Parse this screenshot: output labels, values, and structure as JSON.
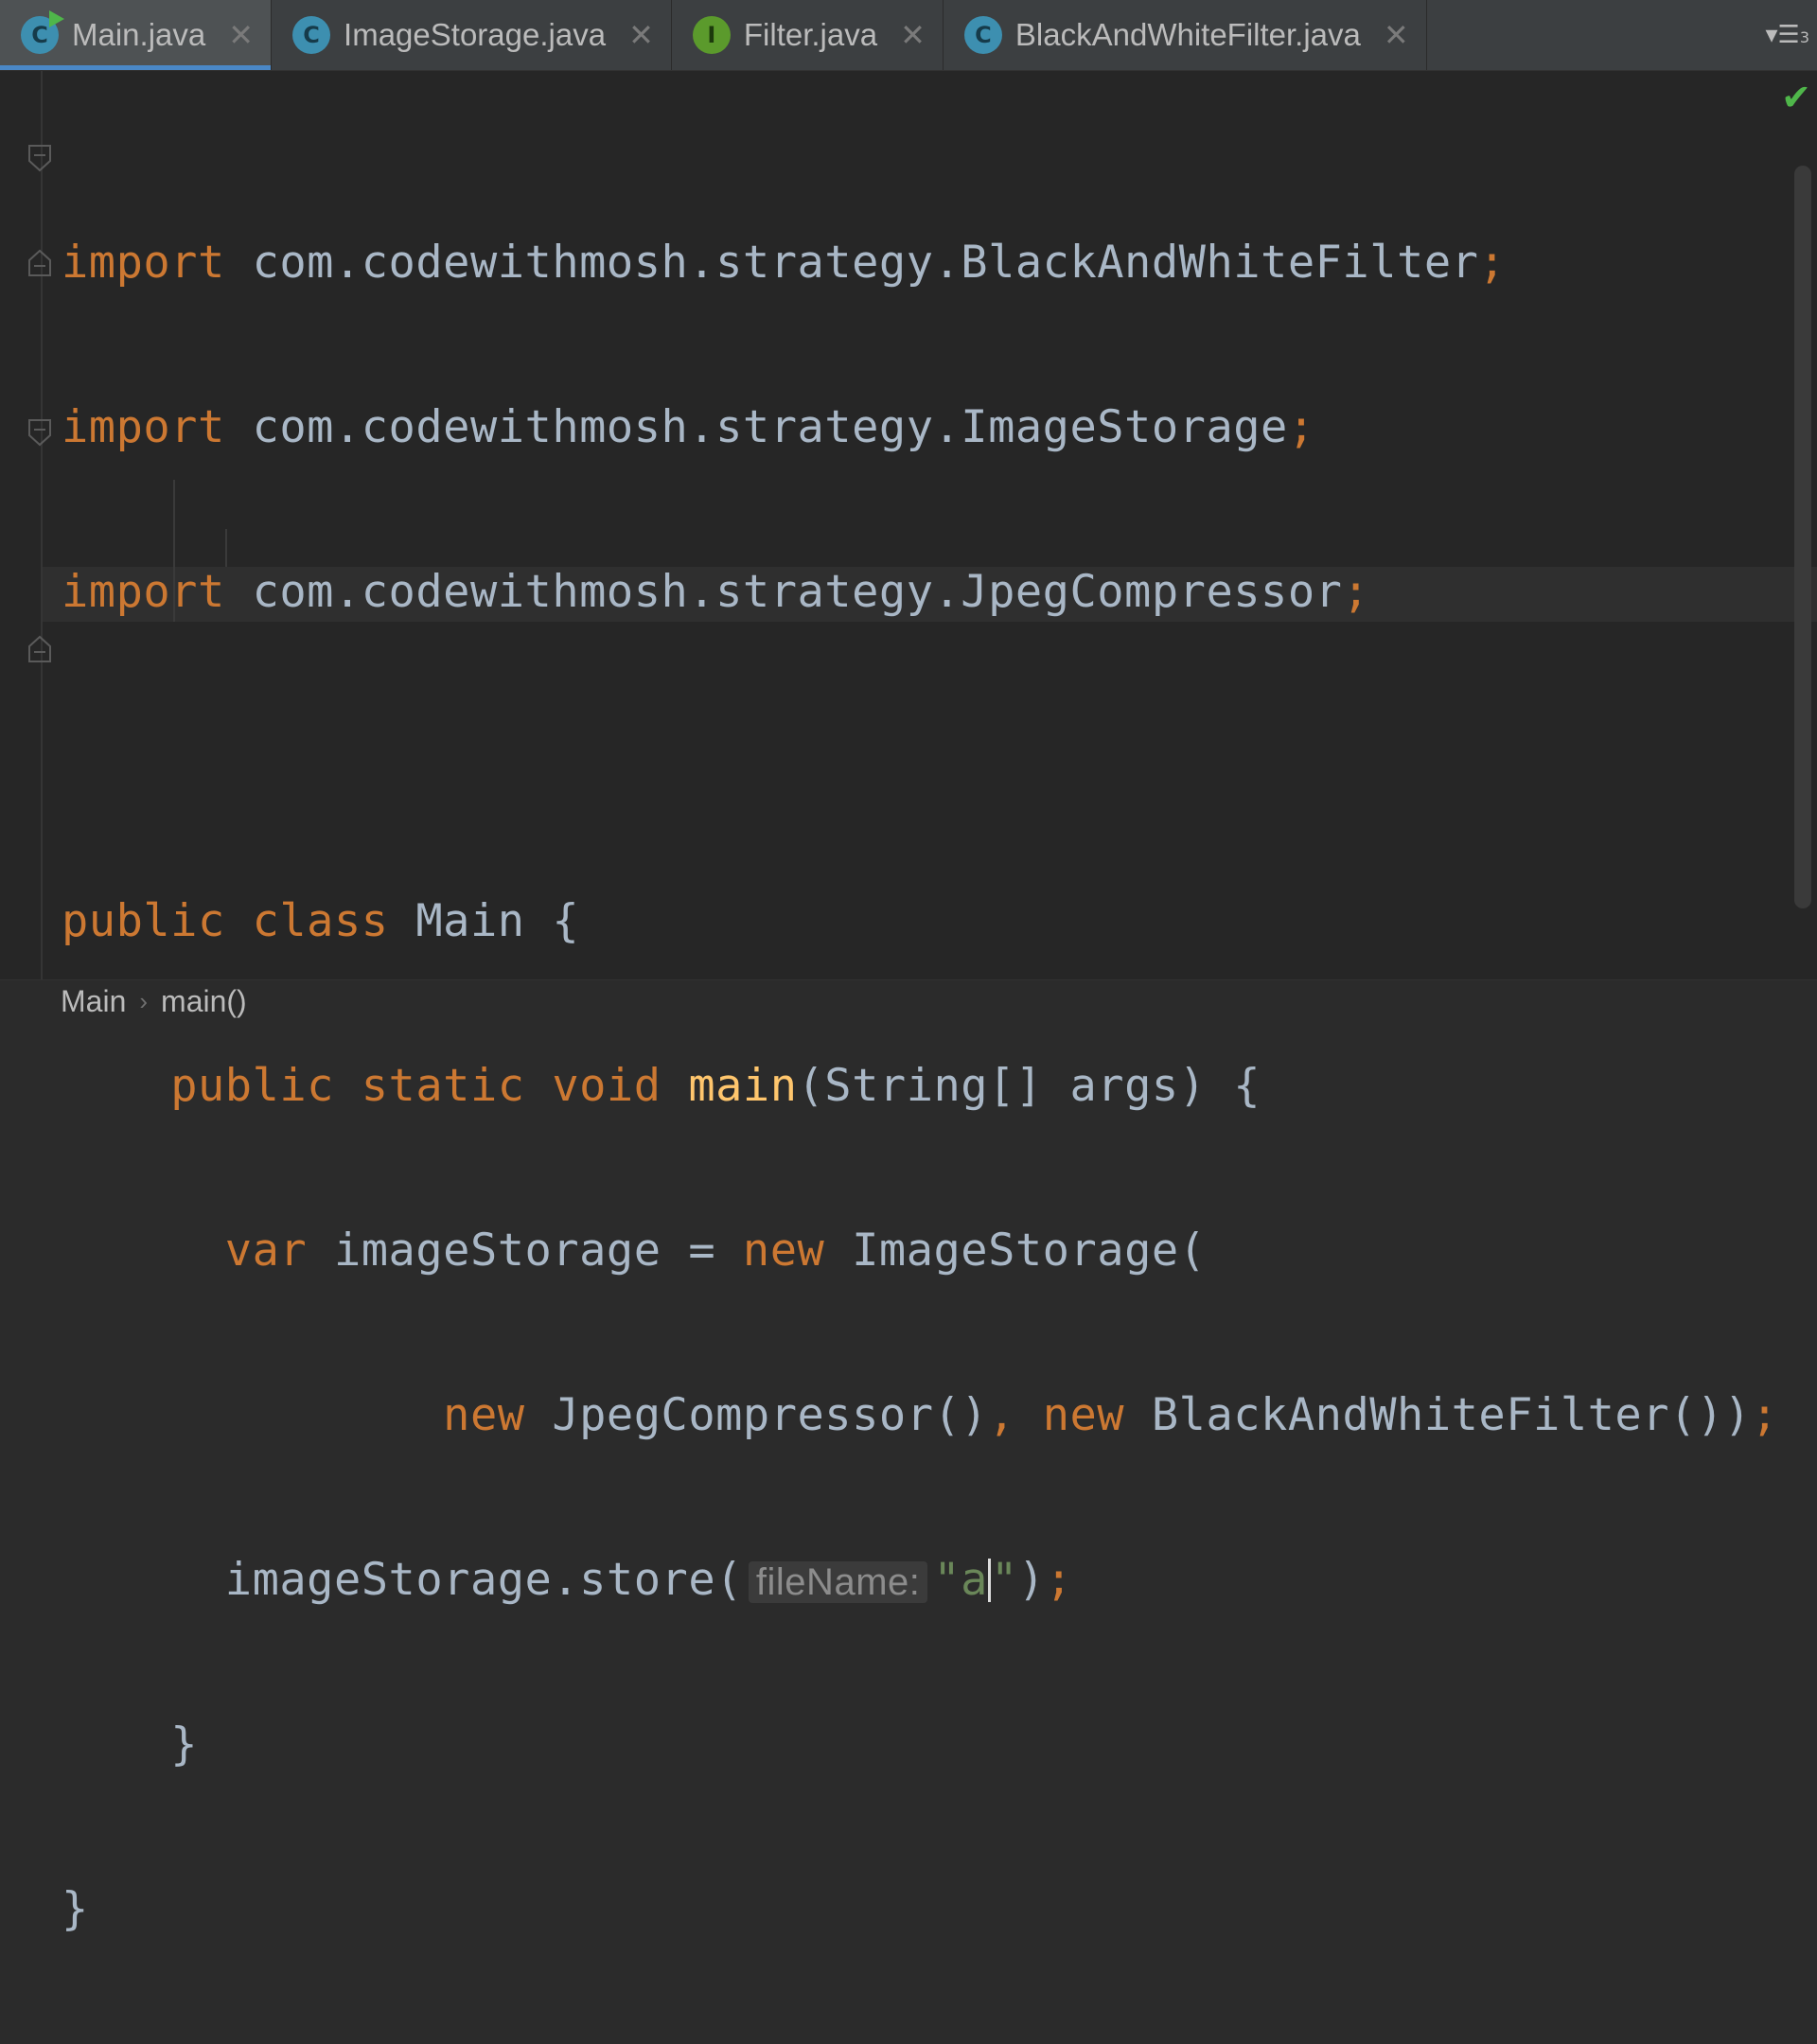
{
  "tabs": [
    {
      "label": "Main.java",
      "icon": "C",
      "kind": "class",
      "active": true,
      "runnable": true
    },
    {
      "label": "ImageStorage.java",
      "icon": "C",
      "kind": "class"
    },
    {
      "label": "Filter.java",
      "icon": "I",
      "kind": "interface"
    },
    {
      "label": "BlackAndWhiteFilter.java",
      "icon": "C",
      "kind": "class"
    }
  ],
  "tab_close_glyph": "✕",
  "tab_menu": {
    "glyph": "▾☰",
    "count": "3"
  },
  "code": {
    "line1": {
      "kw": "import",
      "rest": " com.codewithmosh.strategy.BlackAndWhiteFilter",
      "semi": ";"
    },
    "line2": {
      "kw": "import",
      "rest": " com.codewithmosh.strategy.ImageStorage",
      "semi": ";"
    },
    "line3": {
      "kw": "import",
      "rest": " com.codewithmosh.strategy.JpegCompressor",
      "semi": ";"
    },
    "line5": {
      "kw": "public class",
      "rest": " Main {"
    },
    "line6": {
      "kw": "public static void",
      "fn": "main",
      "rest": "(String[] args) {"
    },
    "line7": {
      "kw": "var",
      "mid": " imageStorage = ",
      "kw2": "new",
      "rest": " ImageStorage("
    },
    "line8": {
      "kw": "new",
      "mid": " JpegCompressor()",
      "comma": ",",
      "kw2": "new",
      "rest": " BlackAndWhiteFilter())",
      "semi": ";"
    },
    "line9": {
      "pre": "imageStorage.store(",
      "hint": "fileName:",
      "str_open": "\"a",
      "str_close": "\"",
      "post": ")",
      "semi": ";"
    },
    "line10": {
      "text": "}"
    },
    "line11": {
      "text": "}"
    }
  },
  "breadcrumb": [
    "Main",
    "main()"
  ],
  "breadcrumb_sep": "›",
  "status_check": "✔",
  "colors": {
    "keyword": "#cc7832",
    "function": "#ffc66d",
    "string": "#6a8759",
    "text": "#a9b7c6",
    "accent": "#4a88c7"
  }
}
